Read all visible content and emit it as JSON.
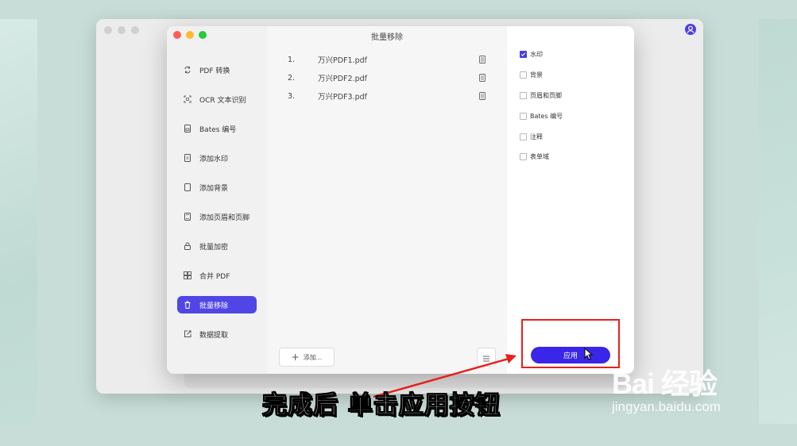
{
  "window_title": "批量移除",
  "sidebar": {
    "items": [
      {
        "label": "PDF 转换",
        "icon": "convert-icon"
      },
      {
        "label": "OCR 文本识别",
        "icon": "ocr-icon"
      },
      {
        "label": "Bates 编号",
        "icon": "bates-icon"
      },
      {
        "label": "添加水印",
        "icon": "watermark-icon"
      },
      {
        "label": "添加背景",
        "icon": "background-icon"
      },
      {
        "label": "添加页眉和页脚",
        "icon": "header-footer-icon"
      },
      {
        "label": "批量加密",
        "icon": "lock-icon"
      },
      {
        "label": "合并 PDF",
        "icon": "merge-icon"
      },
      {
        "label": "批量移除",
        "icon": "trash-icon",
        "active": true
      },
      {
        "label": "数据提取",
        "icon": "extract-icon"
      }
    ]
  },
  "files": [
    {
      "num": "1.",
      "name": "万兴PDF1.pdf"
    },
    {
      "num": "2.",
      "name": "万兴PDF2.pdf"
    },
    {
      "num": "3.",
      "name": "万兴PDF3.pdf"
    }
  ],
  "add_button": {
    "icon": "plus-icon",
    "label": "添加..."
  },
  "options": [
    {
      "label": "水印",
      "checked": true
    },
    {
      "label": "背景",
      "checked": false
    },
    {
      "label": "页眉和页脚",
      "checked": false
    },
    {
      "label": "Bates 编号",
      "checked": false
    },
    {
      "label": "注释",
      "checked": false
    },
    {
      "label": "表单域",
      "checked": false
    }
  ],
  "apply_button": {
    "label": "应用"
  },
  "caption": "完成后 单击应用按钮",
  "watermark": {
    "logo": "Bai 经验",
    "url": "jingyan.baidu.com"
  },
  "colors": {
    "accent": "#5046e5",
    "apply": "#3a26e8",
    "highlight": "#e8201a"
  }
}
